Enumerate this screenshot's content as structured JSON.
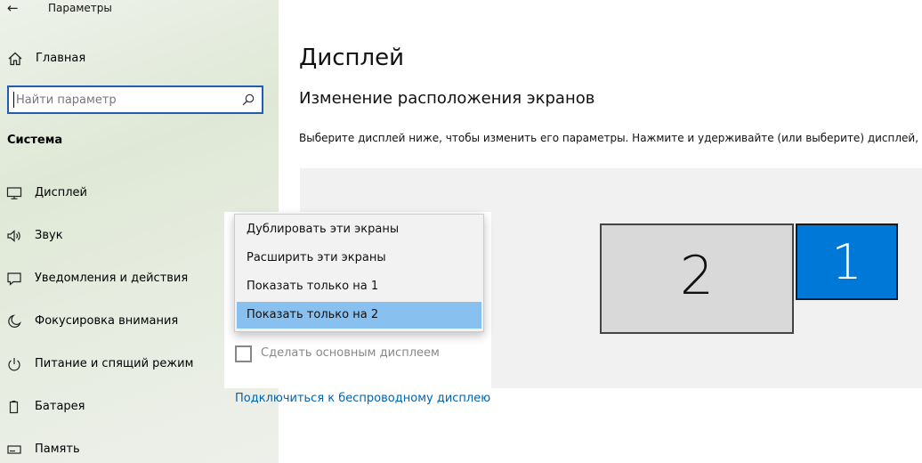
{
  "window": {
    "title": "Параметры"
  },
  "sidebar": {
    "home_label": "Главная",
    "search": {
      "placeholder": "Найти параметр",
      "value": ""
    },
    "section_title": "Система",
    "items": [
      {
        "label": "Дисплей",
        "icon": "monitor-icon"
      },
      {
        "label": "Звук",
        "icon": "speaker-icon"
      },
      {
        "label": "Уведомления и действия",
        "icon": "notification-icon"
      },
      {
        "label": "Фокусировка внимания",
        "icon": "moon-icon"
      },
      {
        "label": "Питание и спящий режим",
        "icon": "power-icon"
      },
      {
        "label": "Батарея",
        "icon": "battery-icon"
      },
      {
        "label": "Память",
        "icon": "storage-icon"
      }
    ]
  },
  "main": {
    "title": "Дисплей",
    "subtitle": "Изменение расположения экранов",
    "description": "Выберите дисплей ниже, чтобы изменить его параметры. Нажмите и удерживайте (или выберите) дисплей, а",
    "monitors": [
      {
        "number": "2",
        "selected": false
      },
      {
        "number": "1",
        "selected": true
      }
    ],
    "dropdown": {
      "options": [
        "Дублировать эти экраны",
        "Расширить эти экраны",
        "Показать только на 1",
        "Показать только на 2"
      ],
      "selected_index": 3
    },
    "make_primary": {
      "label": "Сделать основным дисплеем",
      "checked": false,
      "enabled": false
    },
    "wireless_link": "Подключиться к беспроводному дисплею"
  },
  "colors": {
    "accent": "#0078d7",
    "selection": "#88c0ef",
    "link": "#0063b1"
  }
}
